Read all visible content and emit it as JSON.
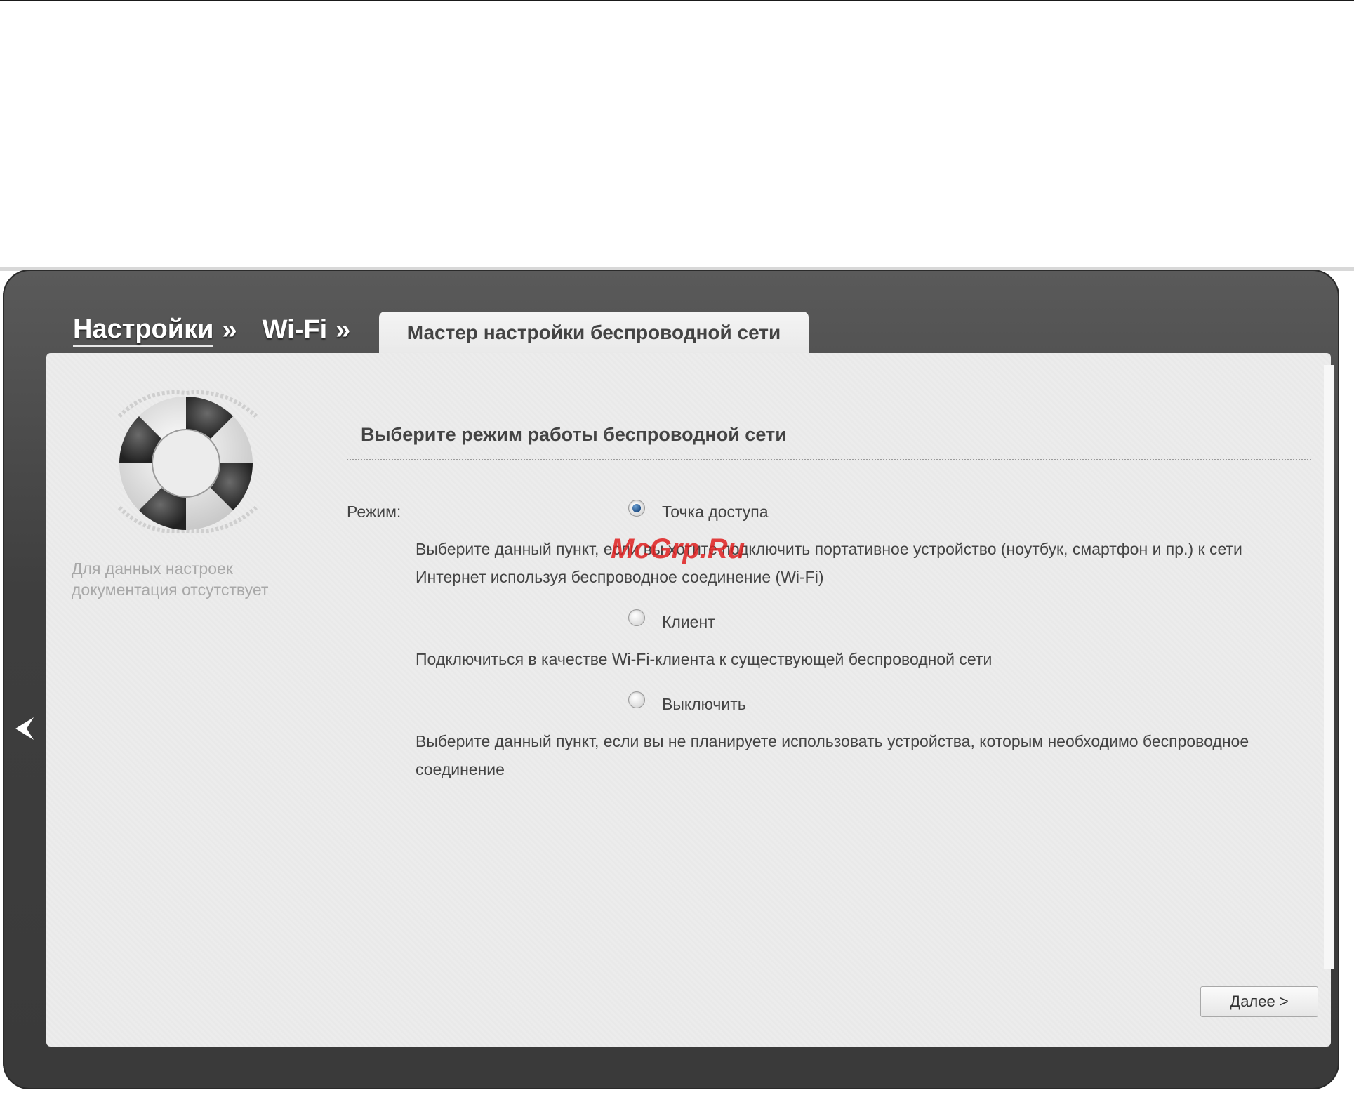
{
  "breadcrumb": {
    "items": [
      {
        "label": "Настройки",
        "sep": "»"
      },
      {
        "label": "Wi-Fi",
        "sep": "»"
      }
    ],
    "active_tab": "Мастер настройки беспроводной сети"
  },
  "help": {
    "icon": "lifebuoy-icon",
    "text": "Для данных настроек документация отсутствует"
  },
  "wizard": {
    "title": "Выберите режим работы беспроводной сети",
    "mode_label": "Режим:",
    "options": [
      {
        "label": "Точка доступа",
        "selected": true,
        "description": "Выберите данный пункт, если вы хотите подключить портативное устройство (ноутбук, смартфон и пр.) к сети Интернет используя беспроводное соединение (Wi-Fi)"
      },
      {
        "label": "Клиент",
        "selected": false,
        "description": "Подключиться в качестве Wi-Fi-клиента к существующей беспроводной сети"
      },
      {
        "label": "Выключить",
        "selected": false,
        "description": "Выберите данный пункт, если вы не планируете использовать устройства, которым необходимо беспроводное соединение"
      }
    ],
    "next_label": "Далее >"
  },
  "watermark": "McGrp.Ru"
}
